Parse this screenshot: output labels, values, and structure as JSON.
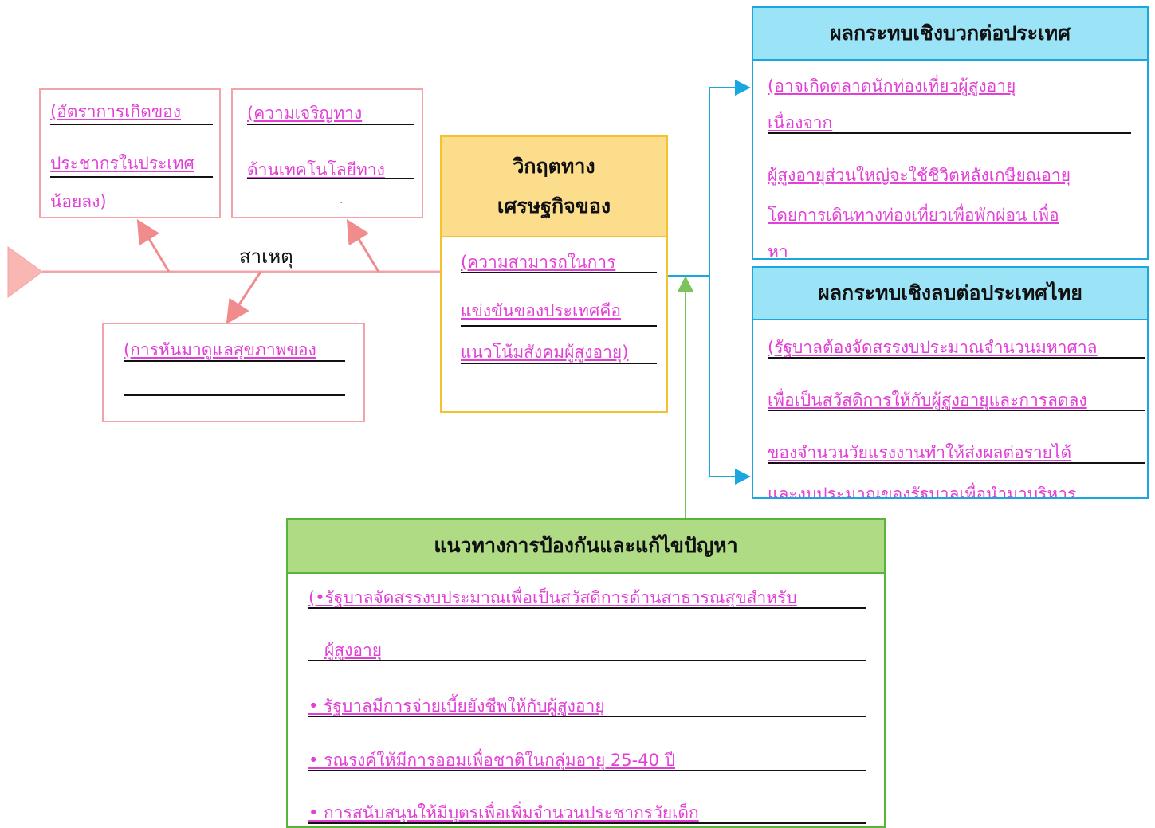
{
  "cause_label": "สาเหตุ",
  "causes": [
    {
      "lines": [
        "(อัตราการเกิดของ",
        "ประชากรในประเทศ",
        "น้อยลง)"
      ]
    },
    {
      "lines": [
        "(ความเจริญทาง",
        "ด้านเทคโนโลยีทาง",
        "."
      ]
    },
    {
      "lines": [
        "(การหันมาดูแลสุขภาพของ"
      ]
    }
  ],
  "problem": {
    "title_lines": [
      "วิกฤตทาง",
      "เศรษฐกิจของ"
    ],
    "lines": [
      "(ความสามารถในการ",
      "แข่งขันของประเทศคือ",
      "แนวโน้มสังคมผู้สูงอายุ)"
    ]
  },
  "positive": {
    "title": "ผลกระทบเชิงบวกต่อประเทศ",
    "lines": [
      "(อาจเกิดตลาดนักท่องเที่ยวผู้สูงอายุ",
      "เนื่องจาก",
      "ผู้สูงอายุส่วนใหญ่จะใช้ชีวิตหลังเกษียณอายุ",
      "โดยการเดินทางท่องเที่ยวเพื่อพักผ่อน เพื่อ",
      "หา"
    ]
  },
  "negative": {
    "title": "ผลกระทบเชิงลบต่อประเทศไทย",
    "lines": [
      "(รัฐบาลต้องจัดสรรงบประมาณจำนวนมหาศาล",
      "เพื่อเป็นสวัสดิการให้กับผู้สูงอายุและการลดลง",
      "ของจำนวนวัยแรงงานทำให้ส่งผลต่อรายได้",
      "และงบประมาณของรัฐบาลเพื่อนำมาบริหาร"
    ]
  },
  "solution": {
    "title": "แนวทางการป้องกันและแก้ไขปัญหา",
    "lines": [
      "(•รัฐบาลจัดสรรงบประมาณเพื่อเป็นสวัสดิการด้านสาธารณสุขสำหรับ",
      "ผู้สูงอายุ",
      "• รัฐบาลมีการจ่ายเบี้ยยังชีพให้กับผู้สูงอายุ",
      "• รณรงค์ให้มีการออมเพื่อชาติในกลุ่มอายุ 25-40 ปี",
      "• การสนับสนุนให้มีบุตรเพื่อเพิ่มจำนวนประชากรวัยเด็ก"
    ]
  },
  "colors": {
    "cause_border": "#f4a3a8",
    "problem_header": "#fbdd8c",
    "effect_header": "#9be3f7",
    "solution_header": "#b0db85",
    "answer_text": "#e23fd6"
  }
}
